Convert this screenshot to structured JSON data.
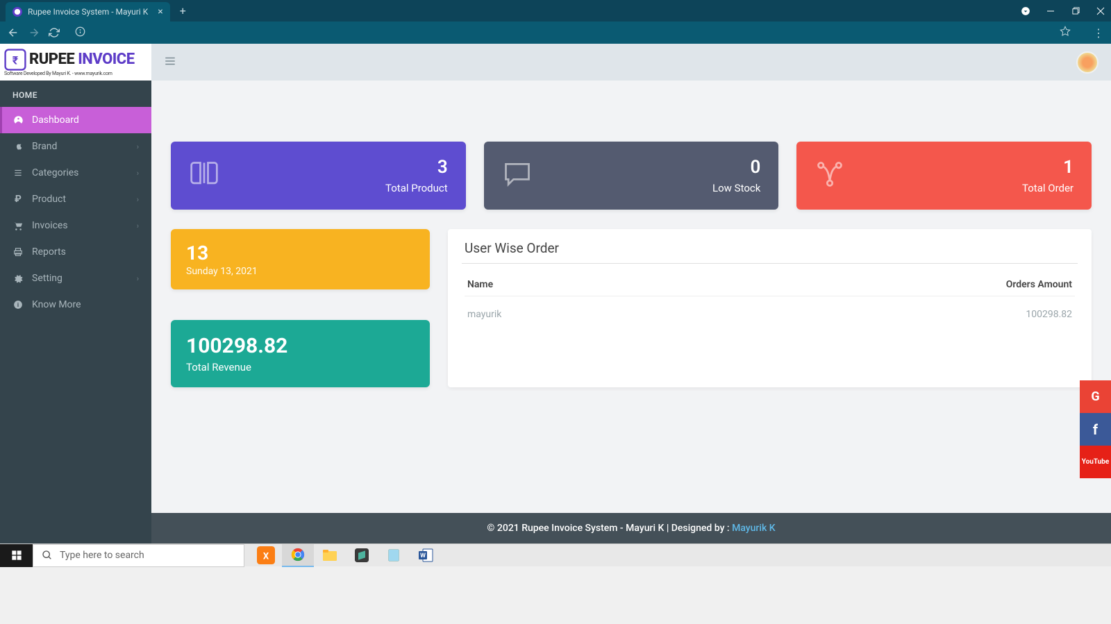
{
  "browser": {
    "tab_title": "Rupee Invoice System - Mayuri K"
  },
  "logo": {
    "line1a": "RUPEE ",
    "line1b": "INVOICE",
    "subtitle": "Software Developed By Mayuri K. - www.mayurik.com"
  },
  "sidebar": {
    "section": "HOME",
    "items": [
      {
        "label": "Dashboard",
        "icon": "dashboard",
        "active": true
      },
      {
        "label": "Brand",
        "icon": "apple",
        "expandable": true
      },
      {
        "label": "Categories",
        "icon": "list",
        "expandable": true
      },
      {
        "label": "Product",
        "icon": "rupee",
        "expandable": true
      },
      {
        "label": "Invoices",
        "icon": "cart",
        "expandable": true
      },
      {
        "label": "Reports",
        "icon": "print"
      },
      {
        "label": "Setting",
        "icon": "gear",
        "expandable": true
      },
      {
        "label": "Know More",
        "icon": "info"
      }
    ]
  },
  "stats": {
    "product": {
      "value": "3",
      "label": "Total Product"
    },
    "lowstock": {
      "value": "0",
      "label": "Low Stock"
    },
    "order": {
      "value": "1",
      "label": "Total Order"
    }
  },
  "date": {
    "day": "13",
    "full": "Sunday 13, 2021"
  },
  "revenue": {
    "value": "100298.82",
    "label": "Total Revenue"
  },
  "table": {
    "title": "User Wise Order",
    "headers": {
      "name": "Name",
      "amount": "Orders Amount"
    },
    "rows": [
      {
        "name": "mayurik",
        "amount": "100298.82"
      }
    ]
  },
  "footer": {
    "text": "© 2021 Rupee Invoice System - Mayuri K | Designed by : ",
    "link": "Mayurik K"
  },
  "social": {
    "g": "G",
    "f": "f",
    "y_top": "You",
    "y_bot": "Tube"
  },
  "taskbar": {
    "search_placeholder": "Type here to search"
  }
}
